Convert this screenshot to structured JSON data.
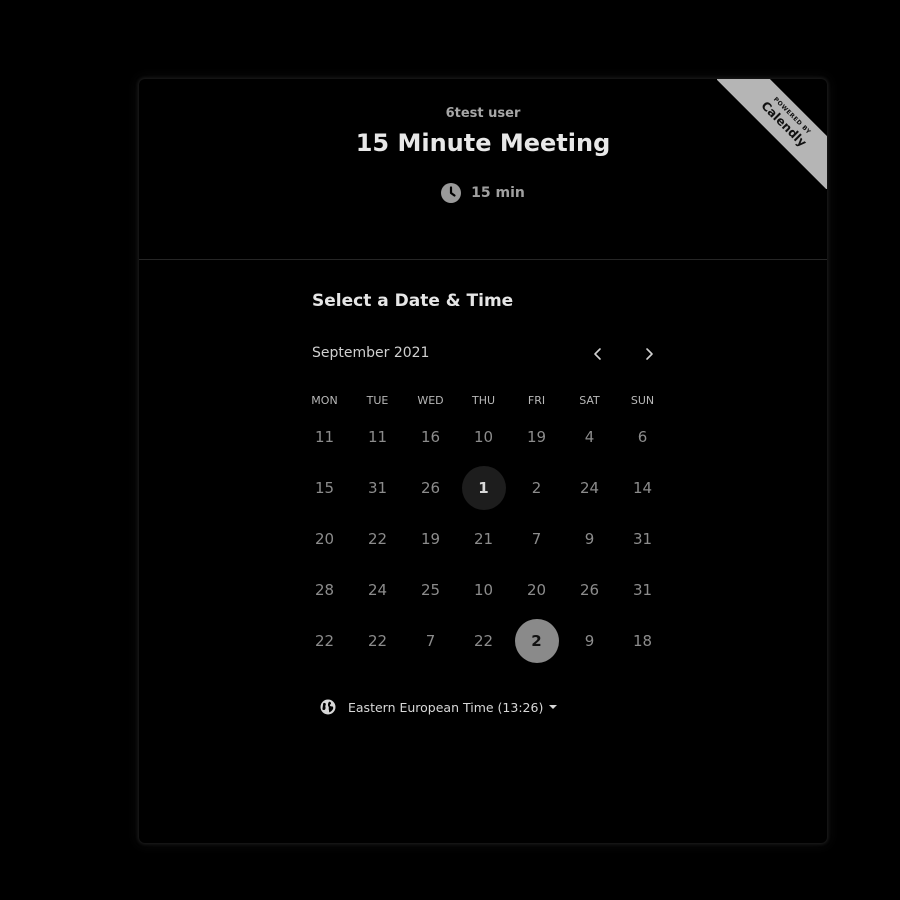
{
  "header": {
    "host_name": "6test user",
    "event_title": "15 Minute Meeting",
    "duration": "15 min",
    "duration_icon": "clock-icon"
  },
  "badge": {
    "small_text": "POWERED BY",
    "brand": "Calendly"
  },
  "calendar": {
    "section_title": "Select a Date & Time",
    "month_label": "September 2021",
    "prev_icon": "chevron-left-icon",
    "next_icon": "chevron-right-icon",
    "weekdays": [
      "MON",
      "TUE",
      "WED",
      "THU",
      "FRI",
      "SAT",
      "SUN"
    ],
    "weeks": [
      [
        "11",
        "11",
        "16",
        "10",
        "19",
        "4",
        "6"
      ],
      [
        "15",
        "31",
        "26",
        "1",
        "2",
        "24",
        "14"
      ],
      [
        "20",
        "22",
        "19",
        "21",
        "7",
        "9",
        "31"
      ],
      [
        "28",
        "24",
        "25",
        "10",
        "20",
        "26",
        "31"
      ],
      [
        "22",
        "22",
        "7",
        "22",
        "2",
        "9",
        "18"
      ]
    ],
    "today": {
      "week": 1,
      "day": 3
    },
    "selected": {
      "week": 4,
      "day": 4
    }
  },
  "timezone": {
    "label": "Eastern European Time (13:26)",
    "icon": "globe-icon"
  },
  "colors": {
    "background": "#000000",
    "selected_day": "#8a8a8a",
    "today_day": "#1d1d1d",
    "ribbon": "#b5b5b5"
  }
}
